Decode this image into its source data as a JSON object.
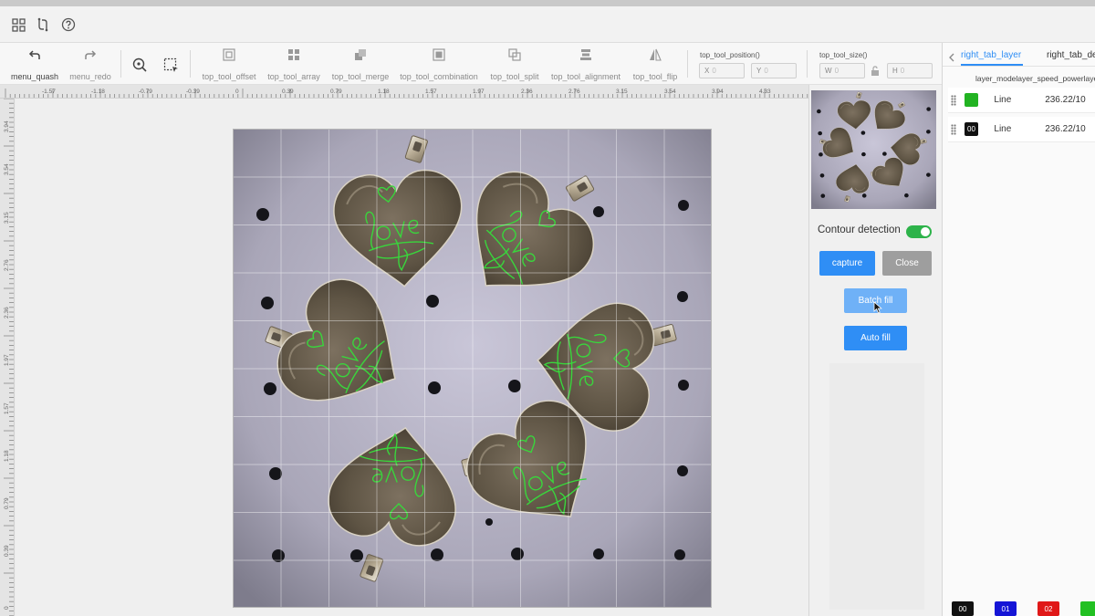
{
  "toolbar": {
    "quash": "menu_quash",
    "redo": "menu_redo",
    "offset": "top_tool_offset",
    "array": "top_tool_array",
    "merge": "top_tool_merge",
    "combination": "top_tool_combination",
    "split": "top_tool_split",
    "alignment": "top_tool_alignment",
    "flip": "top_tool_flip",
    "position_label": "top_tool_position()",
    "x_label": "X",
    "x_value": "0",
    "y_label": "Y",
    "y_value": "0",
    "size_label": "top_tool_size()",
    "w_label": "W",
    "w_value": "0",
    "h_label": "H",
    "h_value": "0"
  },
  "ruler": {
    "horizontal": [
      "-1.57",
      "-1.18",
      "-0.79",
      "-0.39",
      "0",
      "0.39",
      "0.79",
      "1.18",
      "1.57",
      "1.97",
      "2.36",
      "2.76",
      "3.15",
      "3.54",
      "3.94",
      "4.33"
    ],
    "vertical": [
      "3.94",
      "3.54",
      "3.15",
      "2.76",
      "2.36",
      "1.97",
      "1.57",
      "1.18",
      "0.79",
      "0.39",
      "0"
    ]
  },
  "camera_panel": {
    "contour_label": "Contour detection",
    "contour_enabled": true,
    "capture": "capture",
    "close": "Close",
    "batch_fill": "Batch fill",
    "auto_fill": "Auto fill"
  },
  "right_panel": {
    "tab_layer": "right_tab_layer",
    "tab_other": "right_tab_de",
    "subheader": "layer_modelayer_speed_powerlayer",
    "layers": [
      {
        "id": "",
        "color": "#22b322",
        "mode": "Line",
        "speed": "236.22/10"
      },
      {
        "id": "00",
        "color": "#111111",
        "mode": "Line",
        "speed": "236.22/10"
      }
    ],
    "palette": [
      {
        "id": "00",
        "color": "#111111"
      },
      {
        "id": "01",
        "color": "#1515d6"
      },
      {
        "id": "02",
        "color": "#e01818"
      },
      {
        "id": "",
        "color": "#22c022"
      }
    ]
  },
  "colors": {
    "accent": "#2f8ef5",
    "toggle_on": "#2db34a",
    "engrave_line": "#39d63c"
  }
}
